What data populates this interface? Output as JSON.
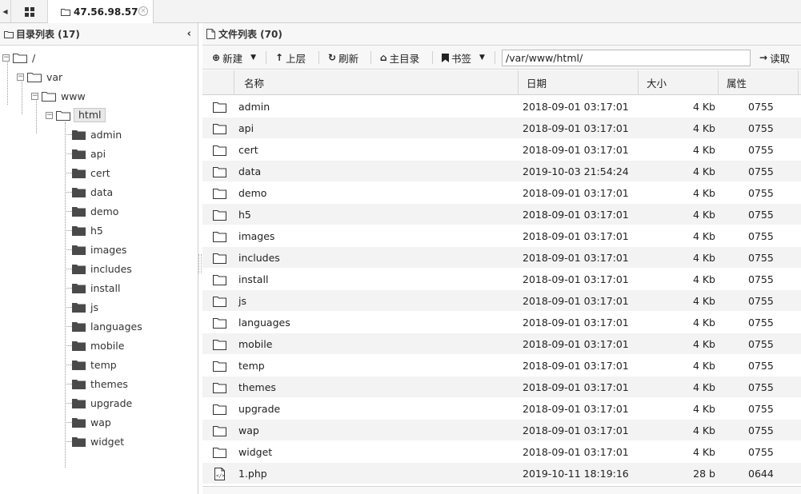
{
  "topbar": {
    "tab_title": "47.56.98.57"
  },
  "left_panel": {
    "title": "目录列表 (17)"
  },
  "tree": {
    "root": "/",
    "var": "var",
    "www": "www",
    "html": "html",
    "children": [
      "admin",
      "api",
      "cert",
      "data",
      "demo",
      "h5",
      "images",
      "includes",
      "install",
      "js",
      "languages",
      "mobile",
      "temp",
      "themes",
      "upgrade",
      "wap",
      "widget"
    ]
  },
  "right_panel": {
    "title": "文件列表 (70)"
  },
  "toolbar": {
    "new_label": "新建",
    "up_label": "上层",
    "refresh_label": "刷新",
    "home_label": "主目录",
    "bookmark_label": "书签",
    "path_value": "/var/www/html/",
    "read_label": "读取"
  },
  "table": {
    "columns": [
      "名称",
      "日期",
      "大小",
      "属性"
    ],
    "rows": [
      {
        "type": "folder",
        "name": "admin",
        "date": "2018-09-01 03:17:01",
        "size": "4 Kb",
        "perm": "0755"
      },
      {
        "type": "folder",
        "name": "api",
        "date": "2018-09-01 03:17:01",
        "size": "4 Kb",
        "perm": "0755"
      },
      {
        "type": "folder",
        "name": "cert",
        "date": "2018-09-01 03:17:01",
        "size": "4 Kb",
        "perm": "0755"
      },
      {
        "type": "folder",
        "name": "data",
        "date": "2019-10-03 21:54:24",
        "size": "4 Kb",
        "perm": "0755"
      },
      {
        "type": "folder",
        "name": "demo",
        "date": "2018-09-01 03:17:01",
        "size": "4 Kb",
        "perm": "0755"
      },
      {
        "type": "folder",
        "name": "h5",
        "date": "2018-09-01 03:17:01",
        "size": "4 Kb",
        "perm": "0755"
      },
      {
        "type": "folder",
        "name": "images",
        "date": "2018-09-01 03:17:01",
        "size": "4 Kb",
        "perm": "0755"
      },
      {
        "type": "folder",
        "name": "includes",
        "date": "2018-09-01 03:17:01",
        "size": "4 Kb",
        "perm": "0755"
      },
      {
        "type": "folder",
        "name": "install",
        "date": "2018-09-01 03:17:01",
        "size": "4 Kb",
        "perm": "0755"
      },
      {
        "type": "folder",
        "name": "js",
        "date": "2018-09-01 03:17:01",
        "size": "4 Kb",
        "perm": "0755"
      },
      {
        "type": "folder",
        "name": "languages",
        "date": "2018-09-01 03:17:01",
        "size": "4 Kb",
        "perm": "0755"
      },
      {
        "type": "folder",
        "name": "mobile",
        "date": "2018-09-01 03:17:01",
        "size": "4 Kb",
        "perm": "0755"
      },
      {
        "type": "folder",
        "name": "temp",
        "date": "2018-09-01 03:17:01",
        "size": "4 Kb",
        "perm": "0755"
      },
      {
        "type": "folder",
        "name": "themes",
        "date": "2018-09-01 03:17:01",
        "size": "4 Kb",
        "perm": "0755"
      },
      {
        "type": "folder",
        "name": "upgrade",
        "date": "2018-09-01 03:17:01",
        "size": "4 Kb",
        "perm": "0755"
      },
      {
        "type": "folder",
        "name": "wap",
        "date": "2018-09-01 03:17:01",
        "size": "4 Kb",
        "perm": "0755"
      },
      {
        "type": "folder",
        "name": "widget",
        "date": "2018-09-01 03:17:01",
        "size": "4 Kb",
        "perm": "0755"
      },
      {
        "type": "file",
        "name": "1.php",
        "date": "2019-10-11 18:19:16",
        "size": "28 b",
        "perm": "0644"
      }
    ]
  }
}
